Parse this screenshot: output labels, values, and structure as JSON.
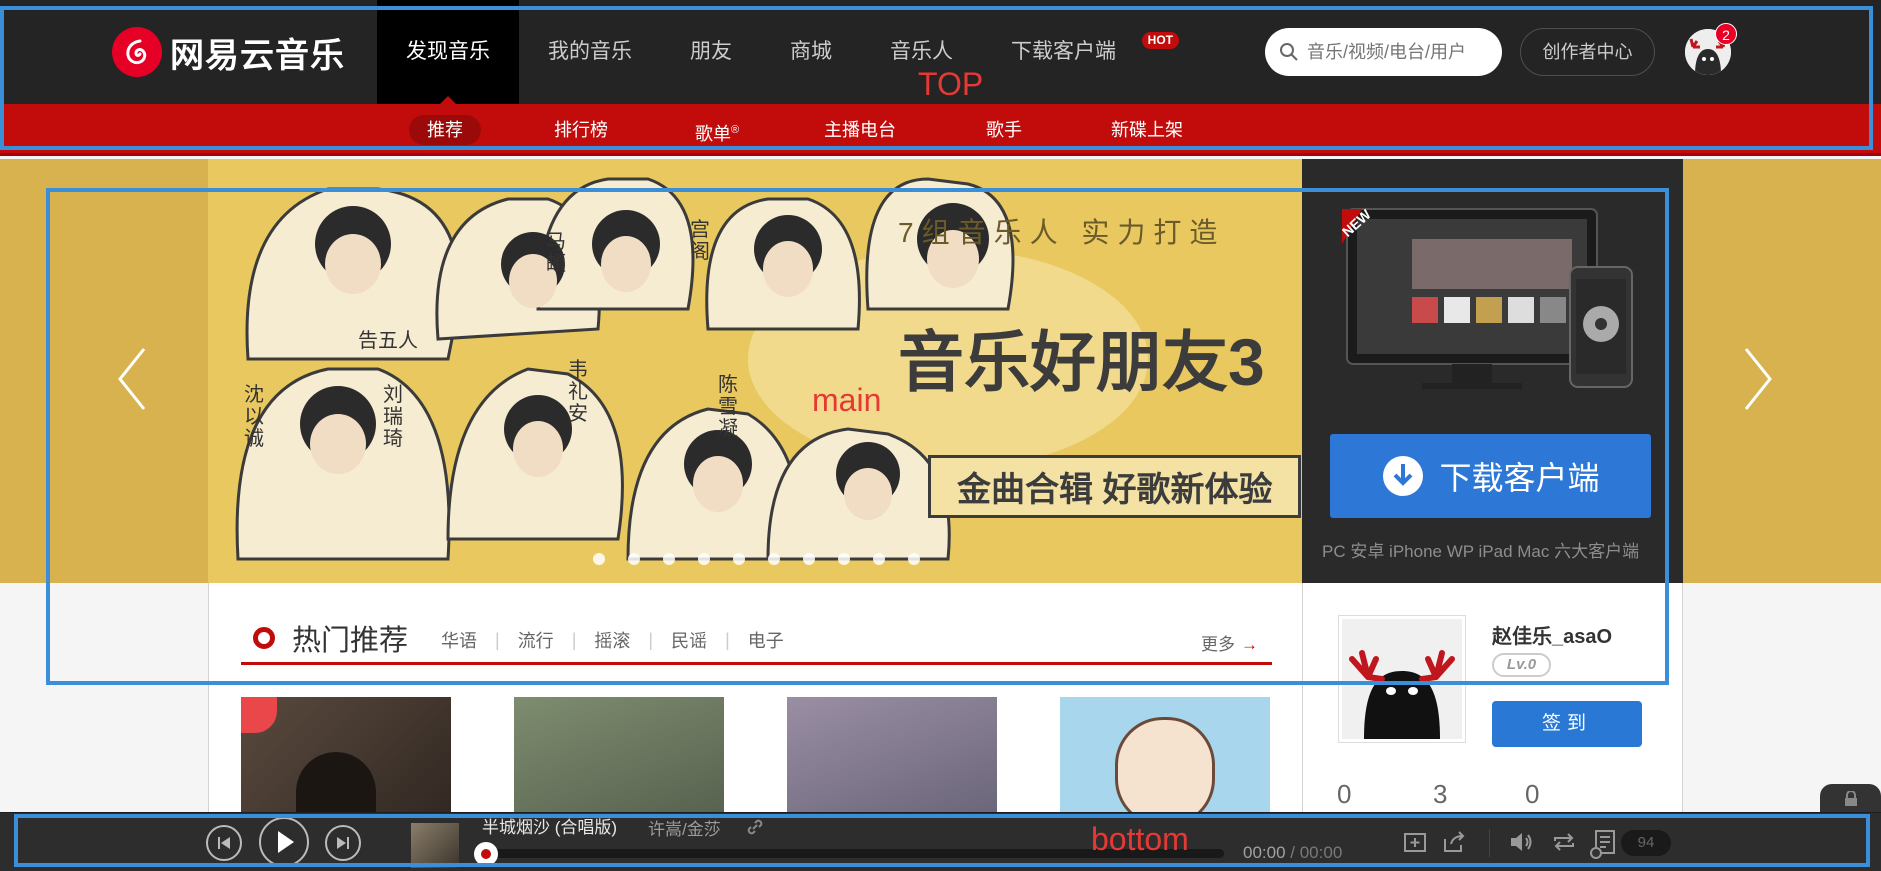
{
  "header": {
    "logo_text": "网易云音乐",
    "nav": [
      {
        "label": "发现音乐",
        "active": true
      },
      {
        "label": "我的音乐"
      },
      {
        "label": "朋友"
      },
      {
        "label": "商城"
      },
      {
        "label": "音乐人"
      },
      {
        "label": "下载客户端",
        "badge": "HOT"
      }
    ],
    "search_placeholder": "音乐/视频/电台/用户",
    "creator_label": "创作者中心",
    "notification_count": "2"
  },
  "subnav": {
    "items": [
      {
        "label": "推荐",
        "active": true
      },
      {
        "label": "排行榜"
      },
      {
        "label": "歌单",
        "mark": "®"
      },
      {
        "label": "主播电台"
      },
      {
        "label": "歌手"
      },
      {
        "label": "新碟上架"
      }
    ]
  },
  "banner": {
    "headline": "7组音乐人 实力打造",
    "title": "音乐好朋友3",
    "slogan": "金曲合辑 好歌新体验",
    "artists": [
      "告五人",
      "马頔",
      "宫阁",
      "沈以诚",
      "刘瑞琦",
      "韦礼安",
      "陈雪凝"
    ],
    "slide_count": 10,
    "active_slide": 0,
    "new_tag": "NEW",
    "download_label": "下载客户端",
    "download_caption": "PC 安卓 iPhone WP iPad Mac 六大客户端"
  },
  "recommend": {
    "title": "热门推荐",
    "tags": [
      "华语",
      "流行",
      "摇滚",
      "民谣",
      "电子"
    ],
    "more_label": "更多"
  },
  "user": {
    "name": "赵佳乐_asaO",
    "level": "Lv.0",
    "signin_label": "签到",
    "stats": [
      "0",
      "3",
      "0"
    ]
  },
  "player": {
    "song_title": "半城烟沙 (合唱版)",
    "artist": "许嵩/金莎",
    "current_time": "00:00",
    "total_time": "/ 00:00",
    "playlist_count": "94",
    "progress": 0
  },
  "annotations": {
    "top_label": "TOP",
    "main_label": "main",
    "bottom_label": "bottom"
  },
  "colors": {
    "brand_red": "#c20c0c",
    "header_bg": "#242424",
    "annotation_blue": "#3a8fd8",
    "annotation_text": "#e53935",
    "download_blue": "#2d78d6"
  }
}
